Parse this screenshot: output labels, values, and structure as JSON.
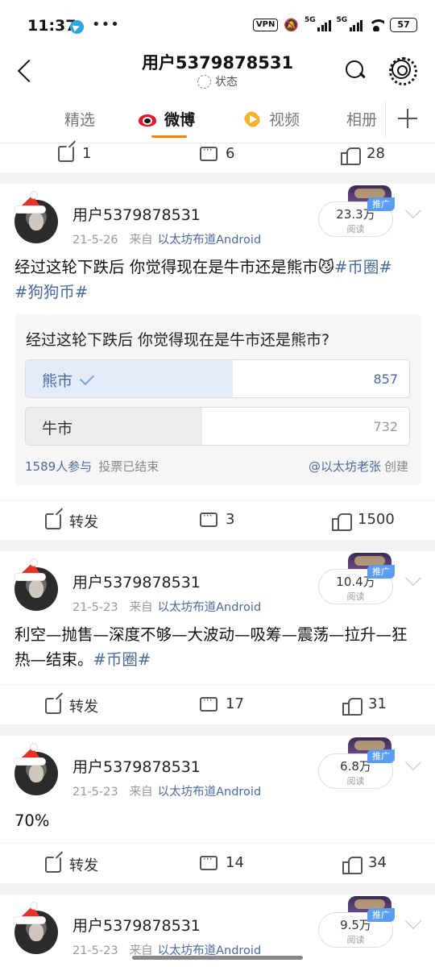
{
  "status_bar": {
    "time": "11:37",
    "more": "•••",
    "vpn": "VPN",
    "sig1_label": "5G",
    "sig2_label": "5G",
    "battery": "57"
  },
  "header": {
    "title": "用户5379878531",
    "status_text": "状态"
  },
  "tabs": [
    {
      "label": "精选"
    },
    {
      "label": "微博"
    },
    {
      "label": "视频"
    },
    {
      "label": "相册"
    }
  ],
  "colors": {
    "accent": "#ff8200",
    "link": "#4b6a9c",
    "poll_win": "#e4ecfa",
    "promo_badge": "#5b9ef1"
  },
  "top_actions": {
    "share": "1",
    "comment": "6",
    "like": "28"
  },
  "posts": [
    {
      "username": "用户5379878531",
      "date": "21-5-26",
      "from_label": "来自",
      "source": "以太坊布道Android",
      "reads": "23.3万",
      "reads_label": "阅读",
      "promo": "推广",
      "text": "经过这轮下跌后 你觉得现在是牛市还是熊市😼",
      "hashtag1": "#币圈#",
      "hashtag2": "#狗狗币#",
      "poll": {
        "question": "经过这轮下跌后 你觉得现在是牛市还是熊市?",
        "options": [
          {
            "label": "熊市",
            "count": "857",
            "share": 0.54
          },
          {
            "label": "牛市",
            "count": "732",
            "share": 0.46
          }
        ],
        "participants": "1589人参与",
        "status": "投票已结束",
        "creator": "@以太坊老张",
        "creator_suffix": "创建"
      },
      "actions": {
        "share": "转发",
        "comment": "3",
        "like": "1500"
      }
    },
    {
      "username": "用户5379878531",
      "date": "21-5-23",
      "from_label": "来自",
      "source": "以太坊布道Android",
      "reads": "10.4万",
      "reads_label": "阅读",
      "promo": "推广",
      "text": "利空—抛售—深度不够—大波动—吸筹—震荡—拉升—狂热—结束。",
      "hashtag1": "#币圈#",
      "actions": {
        "share": "转发",
        "comment": "17",
        "like": "31"
      }
    },
    {
      "username": "用户5379878531",
      "date": "21-5-23",
      "from_label": "来自",
      "source": "以太坊布道Android",
      "reads": "6.8万",
      "reads_label": "阅读",
      "promo": "推广",
      "text": "70%",
      "actions": {
        "share": "转发",
        "comment": "14",
        "like": "34"
      }
    },
    {
      "username": "用户5379878531",
      "date": "21-5-23",
      "from_label": "来自",
      "source": "以太坊布道Android",
      "reads": "9.5万",
      "reads_label": "阅读",
      "promo": "推广"
    }
  ]
}
